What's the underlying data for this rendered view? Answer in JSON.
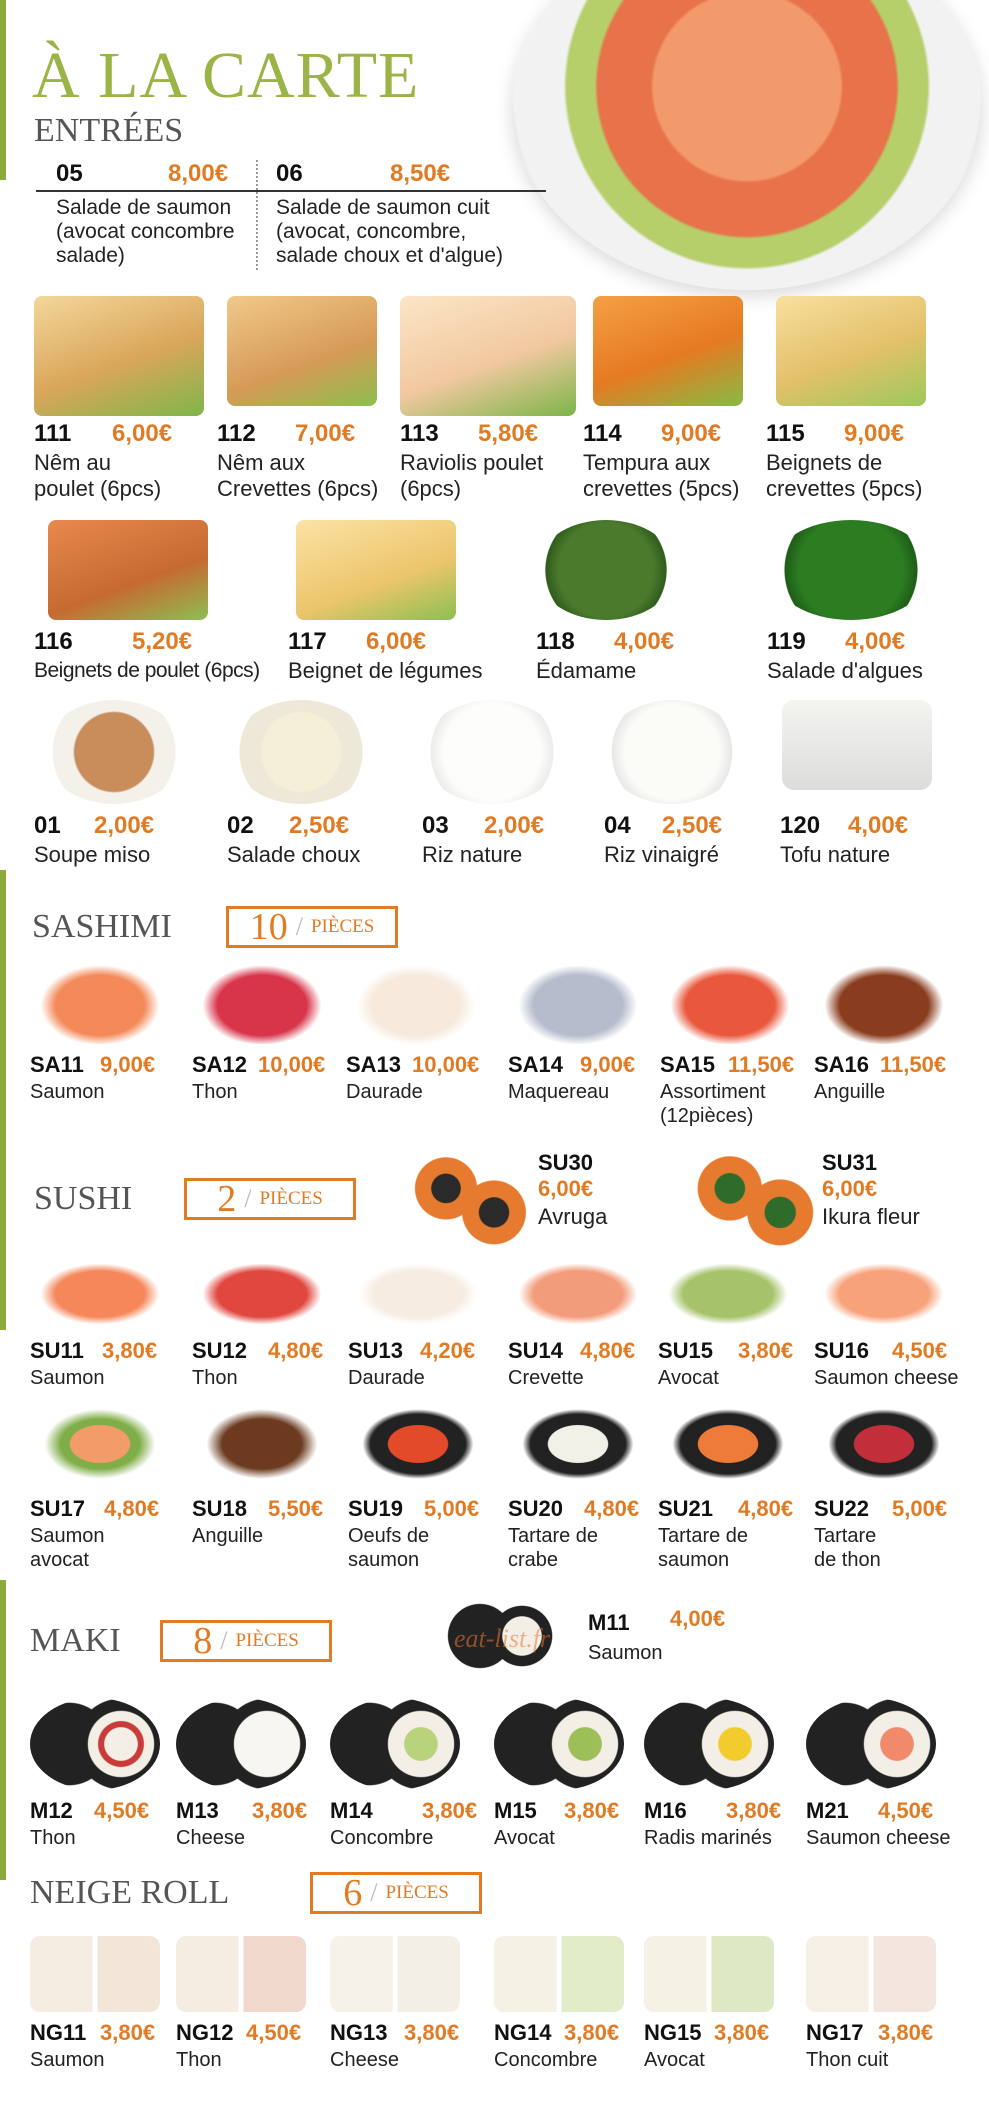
{
  "title": "À LA CARTE",
  "entrees": {
    "heading": "ENTRÉES",
    "items": [
      {
        "code": "05",
        "price": "8,00€",
        "name": "Salade de saumon\n(avocat concombre\nsalade)"
      },
      {
        "code": "06",
        "price": "8,50€",
        "name": "Salade de saumon cuit\n(avocat, concombre,\nsalade choux et d'algue)"
      }
    ],
    "row1": [
      {
        "code": "111",
        "price": "6,00€",
        "name": "Nêm au\npoulet (6pcs)"
      },
      {
        "code": "112",
        "price": "7,00€",
        "name": "Nêm aux\nCrevettes (6pcs)"
      },
      {
        "code": "113",
        "price": "5,80€",
        "name": "Raviolis poulet\n(6pcs)"
      },
      {
        "code": "114",
        "price": "9,00€",
        "name": "Tempura aux\ncrevettes (5pcs)"
      },
      {
        "code": "115",
        "price": "9,00€",
        "name": "Beignets de\ncrevettes (5pcs)"
      }
    ],
    "row2": [
      {
        "code": "116",
        "price": "5,20€",
        "name": "Beignets de poulet (6pcs)"
      },
      {
        "code": "117",
        "price": "6,00€",
        "name": "Beignet de légumes"
      },
      {
        "code": "118",
        "price": "4,00€",
        "name": "Édamame"
      },
      {
        "code": "119",
        "price": "4,00€",
        "name": "Salade d'algues"
      }
    ],
    "row3": [
      {
        "code": "01",
        "price": "2,00€",
        "name": "Soupe miso"
      },
      {
        "code": "02",
        "price": "2,50€",
        "name": "Salade choux"
      },
      {
        "code": "03",
        "price": "2,00€",
        "name": "Riz nature"
      },
      {
        "code": "04",
        "price": "2,50€",
        "name": "Riz vinaigré"
      },
      {
        "code": "120",
        "price": "4,00€",
        "name": "Tofu nature"
      }
    ]
  },
  "sashimi": {
    "heading": "SASHIMI",
    "count": "10",
    "unit": "PIÈCES",
    "items": [
      {
        "code": "SA11",
        "price": "9,00€",
        "name": "Saumon"
      },
      {
        "code": "SA12",
        "price": "10,00€",
        "name": "Thon"
      },
      {
        "code": "SA13",
        "price": "10,00€",
        "name": "Daurade"
      },
      {
        "code": "SA14",
        "price": "9,00€",
        "name": "Maquereau"
      },
      {
        "code": "SA15",
        "price": "11,50€",
        "name": "Assortiment\n(12pièces)"
      },
      {
        "code": "SA16",
        "price": "11,50€",
        "name": "Anguille"
      }
    ]
  },
  "sushi": {
    "heading": "SUSHI",
    "count": "2",
    "unit": "PIÈCES",
    "featured": [
      {
        "code": "SU30",
        "price": "6,00€",
        "name": "Avruga"
      },
      {
        "code": "SU31",
        "price": "6,00€",
        "name": "Ikura fleur"
      }
    ],
    "row1": [
      {
        "code": "SU11",
        "price": "3,80€",
        "name": "Saumon"
      },
      {
        "code": "SU12",
        "price": "4,80€",
        "name": "Thon"
      },
      {
        "code": "SU13",
        "price": "4,20€",
        "name": "Daurade"
      },
      {
        "code": "SU14",
        "price": "4,80€",
        "name": "Crevette"
      },
      {
        "code": "SU15",
        "price": "3,80€",
        "name": "Avocat"
      },
      {
        "code": "SU16",
        "price": "4,50€",
        "name": "Saumon cheese"
      }
    ],
    "row2": [
      {
        "code": "SU17",
        "price": "4,80€",
        "name": "Saumon\navocat"
      },
      {
        "code": "SU18",
        "price": "5,50€",
        "name": "Anguille"
      },
      {
        "code": "SU19",
        "price": "5,00€",
        "name": "Oeufs de\nsaumon"
      },
      {
        "code": "SU20",
        "price": "4,80€",
        "name": "Tartare de\ncrabe"
      },
      {
        "code": "SU21",
        "price": "4,80€",
        "name": "Tartare de\nsaumon"
      },
      {
        "code": "SU22",
        "price": "5,00€",
        "name": "Tartare\nde thon"
      }
    ]
  },
  "maki": {
    "heading": "MAKI",
    "count": "8",
    "unit": "PIÈCES",
    "watermark": "eat-list.fr",
    "featured": {
      "code": "M11",
      "price": "4,00€",
      "name": "Saumon"
    },
    "items": [
      {
        "code": "M12",
        "price": "4,50€",
        "name": "Thon"
      },
      {
        "code": "M13",
        "price": "3,80€",
        "name": "Cheese"
      },
      {
        "code": "M14",
        "price": "3,80€",
        "name": "Concombre"
      },
      {
        "code": "M15",
        "price": "3,80€",
        "name": "Avocat"
      },
      {
        "code": "M16",
        "price": "3,80€",
        "name": "Radis marinés"
      },
      {
        "code": "M21",
        "price": "4,50€",
        "name": "Saumon cheese"
      }
    ]
  },
  "neige": {
    "heading": "NEIGE ROLL",
    "count": "6",
    "unit": "PIÈCES",
    "items": [
      {
        "code": "NG11",
        "price": "3,80€",
        "name": "Saumon"
      },
      {
        "code": "NG12",
        "price": "4,50€",
        "name": "Thon"
      },
      {
        "code": "NG13",
        "price": "3,80€",
        "name": "Cheese"
      },
      {
        "code": "NG14",
        "price": "3,80€",
        "name": "Concombre"
      },
      {
        "code": "NG15",
        "price": "3,80€",
        "name": "Avocat"
      },
      {
        "code": "NG17",
        "price": "3,80€",
        "name": "Thon cuit"
      }
    ]
  }
}
